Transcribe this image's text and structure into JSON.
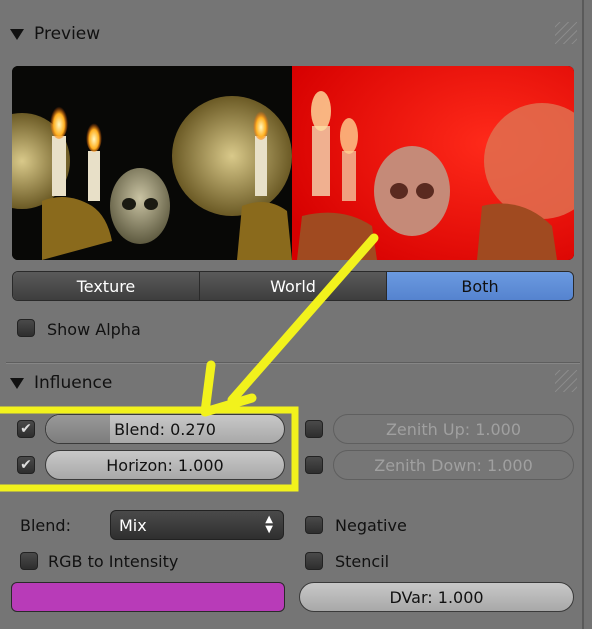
{
  "preview_panel": {
    "title": "Preview",
    "tabs": [
      {
        "label": "Texture",
        "active": false
      },
      {
        "label": "World",
        "active": false
      },
      {
        "label": "Both",
        "active": true
      }
    ],
    "show_alpha": {
      "label": "Show Alpha",
      "checked": false
    }
  },
  "influence_panel": {
    "title": "Influence",
    "blend_factor": {
      "label": "Blend: 0.270",
      "checked": true,
      "value": 0.27
    },
    "horizon_factor": {
      "label": "Horizon: 1.000",
      "checked": true
    },
    "zenith_up": {
      "label": "Zenith Up: 1.000",
      "checked": false
    },
    "zenith_down": {
      "label": "Zenith Down: 1.000",
      "checked": false
    },
    "blend_mode": {
      "label": "Blend:",
      "value": "Mix"
    },
    "negative": {
      "label": "Negative",
      "checked": false
    },
    "rgb_to_intensity": {
      "label": "RGB to Intensity",
      "checked": false
    },
    "stencil": {
      "label": "Stencil",
      "checked": false
    },
    "color": "#b83bb8",
    "dvar": {
      "label": "DVar: 1.000"
    }
  },
  "colors": {
    "highlight": "#f2f21c",
    "active_tab": "#5f8fd9"
  }
}
